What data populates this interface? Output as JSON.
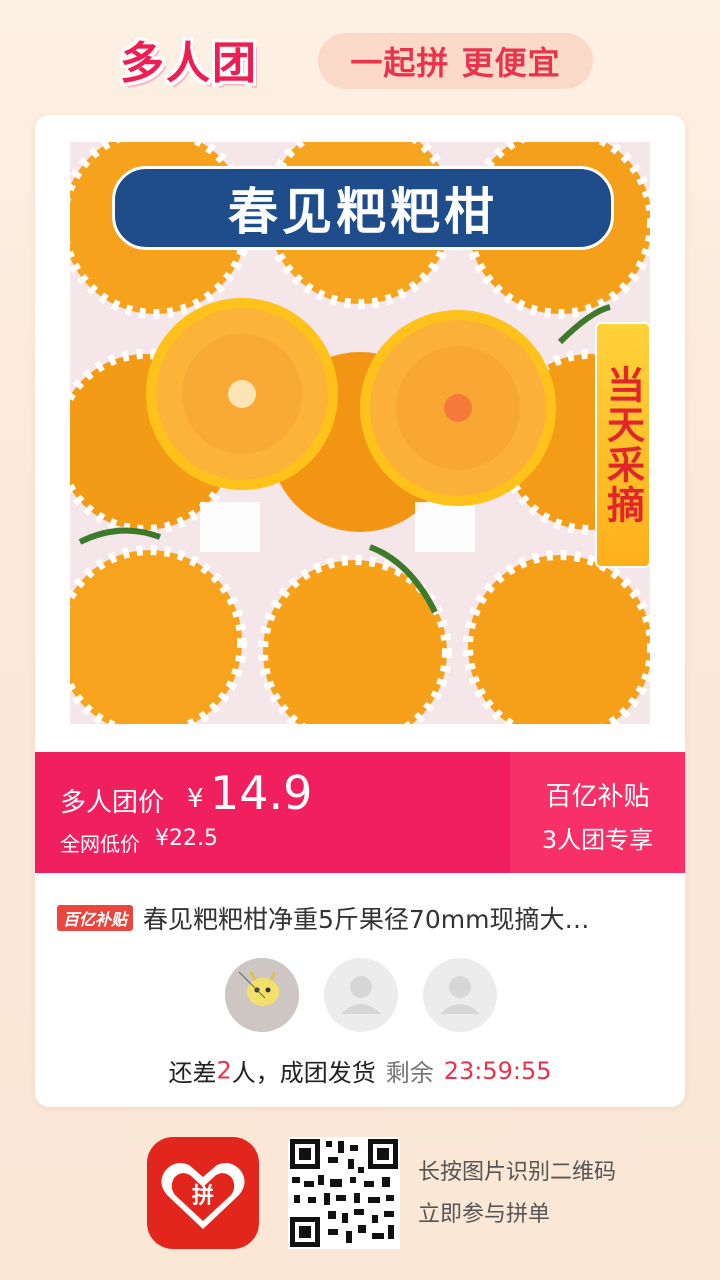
{
  "header": {
    "brand": "多人团",
    "slogan": "一起拼 更便宜"
  },
  "product": {
    "image_banner": "春见粑粑柑",
    "image_tag": "当天采摘",
    "title": "春见粑粑柑净重5斤果径70mm现摘大…"
  },
  "price_bar": {
    "group_price_label": "多人团价",
    "currency": "¥",
    "group_price": "14.9",
    "original_label": "全网低价",
    "original_price": "¥22.5",
    "subsidy_title": "百亿补贴",
    "subsidy_sub": "3人团专享"
  },
  "badge": {
    "subsidy": "百亿补贴"
  },
  "status": {
    "prefix": "还差",
    "count": "2",
    "suffix": "人，成团发货",
    "remaining_label": "剩余",
    "timer": "23:59:55"
  },
  "footer": {
    "line1": "长按图片识别二维码",
    "line2": "立即参与拼单"
  },
  "colors": {
    "accent": "#f0205f",
    "brand": "#ee1d52",
    "background": "#fbe9da"
  }
}
